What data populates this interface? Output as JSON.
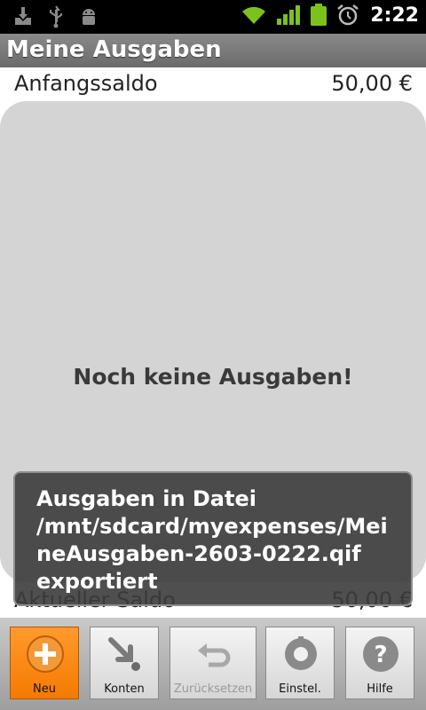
{
  "status_bar": {
    "time": "2:22",
    "icons": [
      "download-icon",
      "usb-icon",
      "android-debug-icon",
      "wifi-icon",
      "signal-icon",
      "battery-icon",
      "alarm-icon"
    ]
  },
  "app": {
    "title": "Meine Ausgaben"
  },
  "account": {
    "start_label": "Anfangssaldo",
    "start_value": "50,00 €",
    "empty_message": "Noch keine Ausgaben!",
    "current_label": "Aktueller Saldo",
    "current_value": "50,00 €"
  },
  "toast": {
    "message": "Ausgaben in Datei /mnt/sdcard/myexpenses/MeineAusgaben-2603-0222.qif exportiert"
  },
  "toolbar": {
    "new_label": "Neu",
    "accounts_label": "Konten",
    "reset_label": "Zurücksetzen",
    "settings_label": "Einstel.",
    "help_label": "Hilfe"
  },
  "colors": {
    "accent": "#f57a00",
    "title_bar": "#7a7a7a",
    "empty_panel": "#d4d4d4"
  }
}
